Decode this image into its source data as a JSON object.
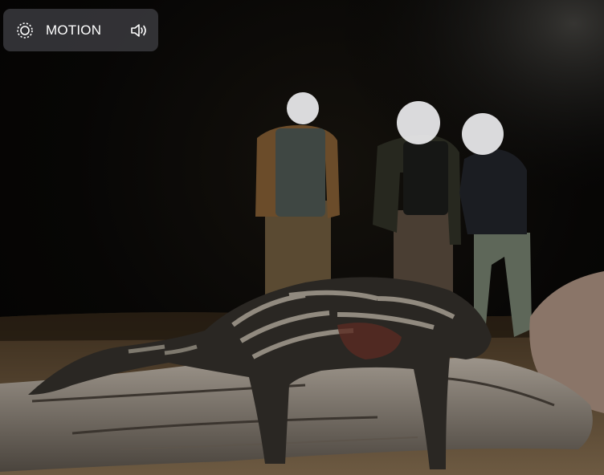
{
  "motion_badge": {
    "label": "MOTION",
    "icon": "motion-live-icon",
    "sound_icon": "speaker-volume-icon"
  },
  "photo": {
    "subject": "night-scene-people-with-civet-on-log"
  },
  "colors": {
    "badge_background": "#3a3a3e",
    "badge_text": "#ffffff",
    "face_blur": "#e6e6e8"
  }
}
